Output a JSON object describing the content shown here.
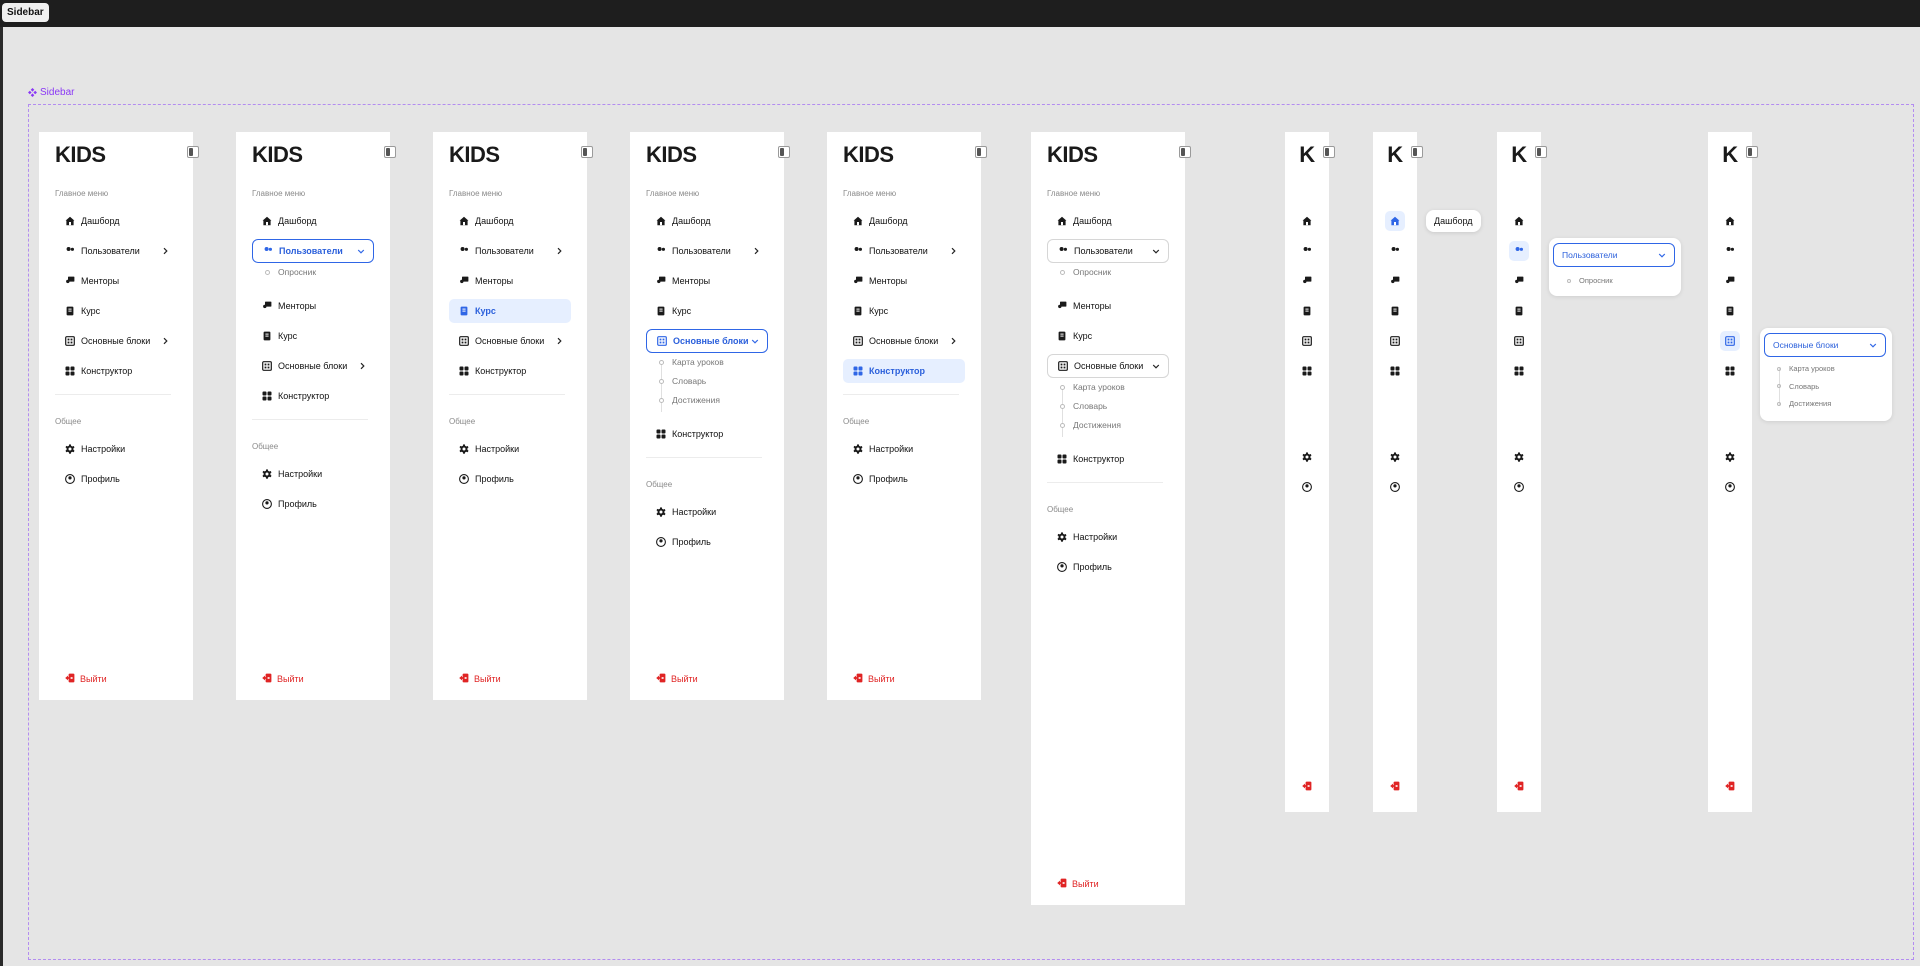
{
  "tab": {
    "label": "Sidebar"
  },
  "frame": {
    "label": "Sidebar"
  },
  "sidebar": {
    "logo_full": "KIDS",
    "logo_short": "K",
    "main_label": "Главное меню",
    "common_label": "Общее",
    "items": {
      "dashboard": "Дашборд",
      "users": "Пользователи",
      "mentors": "Менторы",
      "course": "Курс",
      "blocks": "Основные блоки",
      "constructor": "Конструктор",
      "settings": "Настройки",
      "profile": "Профиль"
    },
    "users_sub": {
      "survey": "Опросник"
    },
    "blocks_sub": {
      "map": "Карта уроков",
      "dictionary": "Словарь",
      "achievements": "Достижения"
    },
    "logout": "Выйти",
    "tooltip": "Дашборд"
  },
  "colors": {
    "accent": "#2f66e6",
    "active_bg": "#e6efff",
    "logout": "#e02424",
    "frame": "#b38cf0"
  },
  "icons": [
    "home-icon",
    "users-icon",
    "mentor-icon",
    "course-icon",
    "blocks-icon",
    "grid-icon",
    "gear-icon",
    "profile-icon",
    "logout-icon",
    "chevron-right-icon",
    "chevron-down-icon",
    "collapse-icon"
  ]
}
